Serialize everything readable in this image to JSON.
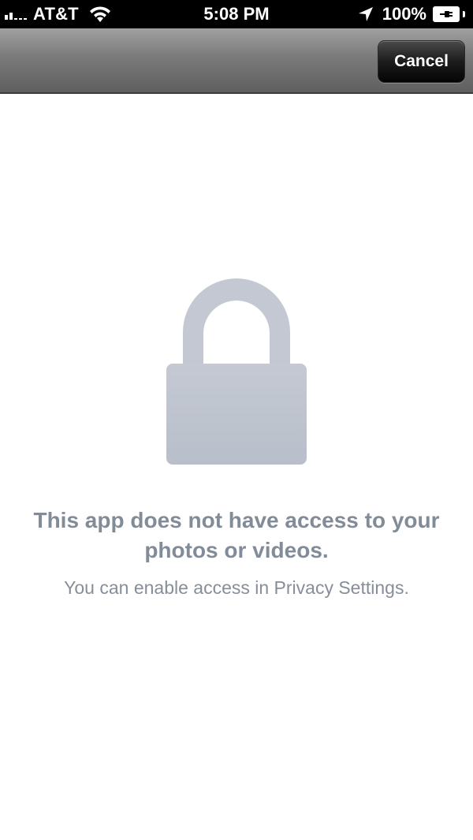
{
  "status_bar": {
    "carrier": "AT&T",
    "time": "5:08 PM",
    "battery_percent": "100%"
  },
  "nav_bar": {
    "cancel_label": "Cancel"
  },
  "content": {
    "lock_icon": "lock-icon",
    "title": "This app does not have access to your photos or videos.",
    "subtitle": "You can enable access in Privacy Settings."
  },
  "colors": {
    "status_bar_bg": "#000000",
    "nav_bar_gradient_top": "#a0a0a0",
    "nav_bar_gradient_bottom": "#5f5f5f",
    "lock_fill": "#c3c8d2",
    "message_text": "#828b98"
  }
}
